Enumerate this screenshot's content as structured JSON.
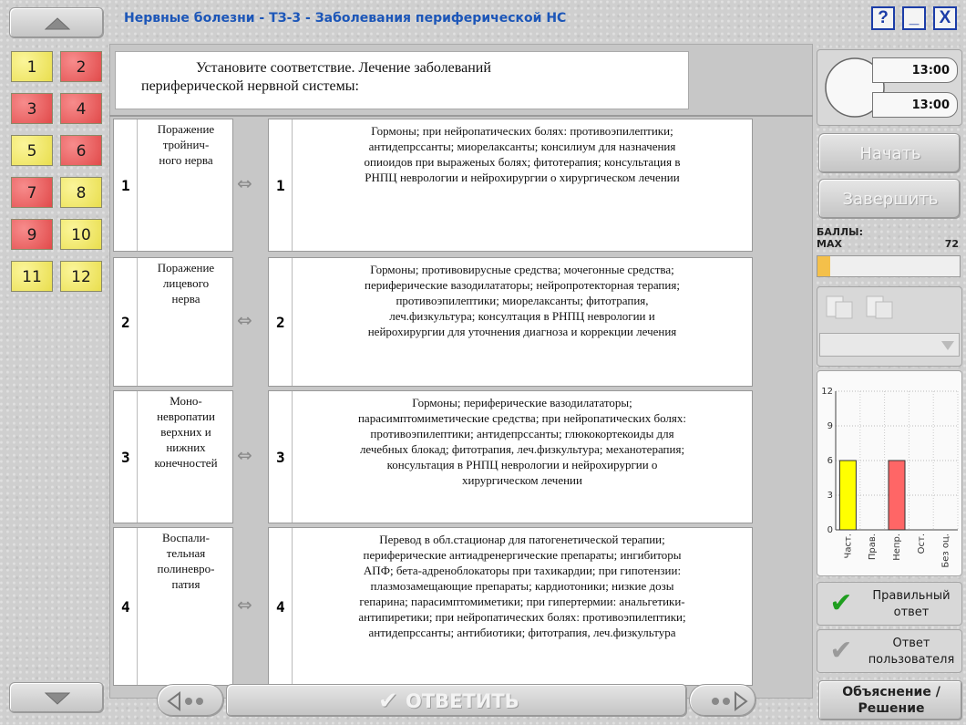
{
  "window": {
    "title": "Нервные болезни - ТЗ-3 - Заболевания периферической НС",
    "help_label": "?",
    "minimize_label": "_",
    "close_label": "X"
  },
  "questions": [
    {
      "label": "1",
      "state": "yellow"
    },
    {
      "label": "2",
      "state": "red"
    },
    {
      "label": "3",
      "state": "red"
    },
    {
      "label": "4",
      "state": "red"
    },
    {
      "label": "5",
      "state": "yellow"
    },
    {
      "label": "6",
      "state": "red"
    },
    {
      "label": "7",
      "state": "red"
    },
    {
      "label": "8",
      "state": "yellow"
    },
    {
      "label": "9",
      "state": "red"
    },
    {
      "label": "10",
      "state": "yellow"
    },
    {
      "label": "11",
      "state": "yellow"
    },
    {
      "label": "12",
      "state": "yellow"
    }
  ],
  "instruction": {
    "line1": "Установите соответствие. Лечение заболеваний",
    "line2": "периферической нервной системы:"
  },
  "rows": [
    {
      "left_num": "1",
      "left_lines": [
        "Поражение",
        "тройнич-",
        "ного нерва"
      ],
      "right_num": "1",
      "right_lines": [
        "Гормоны; при нейропатических болях: противоэпилептики;",
        "антидепрссанты; миорелаксанты; консилиум для назначения",
        "опиоидов при выраженых болях; фитотерапия; консультация в",
        "РНПЦ неврологии и нейрохирургии о хирургическом лечении"
      ]
    },
    {
      "left_num": "2",
      "left_lines": [
        "Поражение",
        "лицевого",
        "нерва"
      ],
      "right_num": "2",
      "right_lines": [
        "Гормоны; противовирусные средства; мочегонные средства;",
        "периферические вазодилататоры; нейропротекторная терапия;",
        "противоэпилептики; миорелаксанты; фитотрапия,",
        "леч.физкультура; консултация в РНПЦ неврологии и",
        "нейрохирургии для уточнения диагноза и коррекции лечения"
      ]
    },
    {
      "left_num": "3",
      "left_lines": [
        "Моно-",
        "невропатии",
        "верхних и",
        "нижних",
        "конечностей"
      ],
      "right_num": "3",
      "right_lines": [
        "Гормоны; периферические вазодилататоры;",
        "парасимптомиметические средства; при нейропатических болях:",
        "противоэпилептики; антидепрссанты; глюкокортекоиды для",
        "лечебных блокад; фитотрапия, леч.физкультура; механотерапия;",
        "консультация в РНПЦ неврологии и нейрохирургии о",
        "хирургическом лечении"
      ]
    },
    {
      "left_num": "4",
      "left_lines": [
        "Воспали-",
        "тельная",
        "полиневро-",
        "патия"
      ],
      "right_num": "4",
      "right_lines": [
        "Перевод в обл.стационар для патогенетической терапии;",
        "периферические антиадренергические препараты; ингибиторы",
        "АПФ; бета-адреноблокаторы при тахикардии; при гипотензии:",
        "плазмозамещающие препараты; кардиотоники; низкие дозы",
        "гепарина; парасимптомиметики; при гипертермии: анальгетики-",
        "антипиретики; при нейропатических болях: противоэпилептики;",
        "антидепрссанты; антибиотики; фитотрапия, леч.физкультура"
      ]
    }
  ],
  "timer": {
    "time1": "13:00",
    "time2": "13:00"
  },
  "controls": {
    "start_label": "Начать",
    "finish_label": "Завершить",
    "score_label": "БАЛЛЫ:",
    "max_label": "MAX",
    "max_value": "72",
    "score_fill_fraction": 0.09,
    "answer_label": "ОТВЕТИТЬ",
    "correct_answer_label": "Правильный ответ",
    "user_answer_label": "Ответ пользователя",
    "explain_label_line1": "Объяснение /",
    "explain_label_line2": "Решение"
  },
  "chart_data": {
    "type": "bar",
    "categories": [
      "Част.",
      "Прав.",
      "Непр.",
      "Ост.",
      "Без оц."
    ],
    "values": [
      6,
      0,
      6,
      0,
      0
    ],
    "colors": [
      "#ffff00",
      "#ffff00",
      "#ff6666",
      "#999999",
      "#999999"
    ],
    "yticks": [
      0,
      3,
      6,
      9,
      12
    ],
    "ylim": [
      0,
      12
    ],
    "grid": true
  }
}
